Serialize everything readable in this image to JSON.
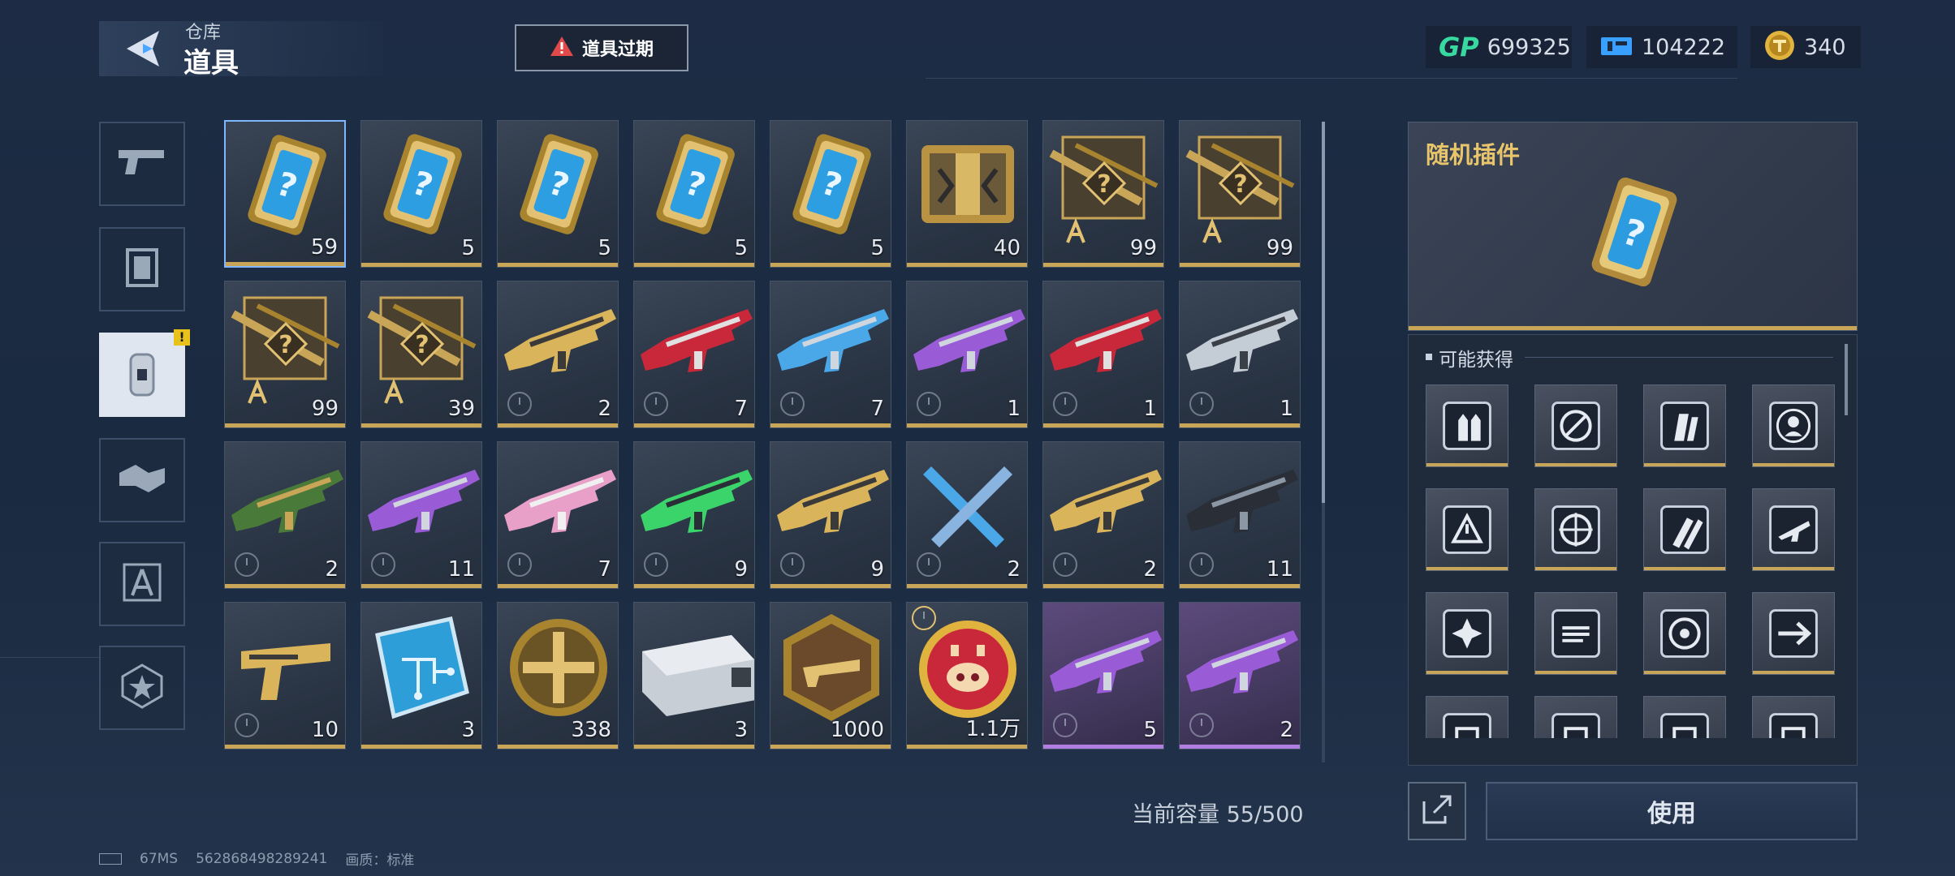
{
  "header": {
    "subtitle": "仓库",
    "title": "道具",
    "expire_button": "道具过期",
    "currencies": [
      {
        "icon": "gp-icon",
        "label": "GP",
        "value": "699325"
      },
      {
        "icon": "ticket-icon",
        "value": "104222"
      },
      {
        "icon": "gold-coin-icon",
        "value": "340"
      }
    ]
  },
  "sidebar": {
    "tabs": [
      {
        "icon": "pistol-icon",
        "active": false
      },
      {
        "icon": "character-frame-icon",
        "active": false
      },
      {
        "icon": "item-bag-icon",
        "active": true,
        "badge": "!"
      },
      {
        "icon": "handshake-icon",
        "active": false
      },
      {
        "icon": "compass-drafting-icon",
        "active": false
      },
      {
        "icon": "star-badge-icon",
        "active": false
      }
    ]
  },
  "inventory": {
    "items": [
      {
        "icon": "random-plugin-card",
        "count": "59",
        "selected": true
      },
      {
        "icon": "random-plugin-card",
        "count": "5"
      },
      {
        "icon": "random-plugin-card",
        "count": "5"
      },
      {
        "icon": "random-plugin-card",
        "count": "5"
      },
      {
        "icon": "random-plugin-card",
        "count": "5"
      },
      {
        "icon": "gold-supply-crate",
        "count": "40"
      },
      {
        "icon": "blueprint-mystery-rifle",
        "count": "99"
      },
      {
        "icon": "blueprint-mystery-rifle",
        "count": "99"
      },
      {
        "icon": "blueprint-mystery-rifle",
        "count": "99"
      },
      {
        "icon": "blueprint-mystery-rifle",
        "count": "39"
      },
      {
        "icon": "gold-rifle-skin",
        "count": "2",
        "timed": true
      },
      {
        "icon": "red-rifle-skin",
        "count": "7",
        "timed": true
      },
      {
        "icon": "blue-rifle-skin",
        "count": "7",
        "timed": true
      },
      {
        "icon": "purple-rifle-skin",
        "count": "1",
        "timed": true
      },
      {
        "icon": "dark-red-rifle-skin",
        "count": "1",
        "timed": true
      },
      {
        "icon": "silver-sniper-skin",
        "count": "1",
        "timed": true
      },
      {
        "icon": "camo-rifle-skin",
        "count": "2",
        "timed": true
      },
      {
        "icon": "purple-rifle-skin",
        "count": "11",
        "timed": true
      },
      {
        "icon": "pink-rifle-skin",
        "count": "7",
        "timed": true
      },
      {
        "icon": "green-rifle-skin",
        "count": "9",
        "timed": true
      },
      {
        "icon": "gold-rifle-skin",
        "count": "9",
        "timed": true
      },
      {
        "icon": "blue-knife-skin",
        "count": "2",
        "timed": true
      },
      {
        "icon": "gold-sniper-skin",
        "count": "2",
        "timed": true
      },
      {
        "icon": "dark-rifle-skin",
        "count": "11",
        "timed": true
      },
      {
        "icon": "gold-pistol-skin",
        "count": "10",
        "timed": true
      },
      {
        "icon": "blue-chip-card",
        "count": "3"
      },
      {
        "icon": "gold-cross-medal",
        "count": "338"
      },
      {
        "icon": "silver-ammo-box",
        "count": "3"
      },
      {
        "icon": "bronze-weapon-badge",
        "count": "1000"
      },
      {
        "icon": "red-pig-coin",
        "count": "1.1万",
        "timed_top": true
      },
      {
        "icon": "purple-smg-skin",
        "count": "5",
        "timed": true,
        "rarity": "purple"
      },
      {
        "icon": "purple-rifle-skin",
        "count": "2",
        "timed": true,
        "rarity": "purple"
      }
    ],
    "capacity_label": "当前容量 55/500"
  },
  "detail": {
    "title": "随机插件",
    "icon": "random-plugin-card",
    "rewards_heading": "可能获得",
    "rewards": [
      {
        "icon": "bullet-upgrade-icon"
      },
      {
        "icon": "no-scope-icon"
      },
      {
        "icon": "magazine-icon"
      },
      {
        "icon": "target-person-icon"
      },
      {
        "icon": "warning-magazine-icon"
      },
      {
        "icon": "crosshair-icon"
      },
      {
        "icon": "ammo-icon"
      },
      {
        "icon": "rifle-plugin-icon"
      },
      {
        "icon": "shuriken-icon"
      },
      {
        "icon": "stock-icon"
      },
      {
        "icon": "scope-ring-icon"
      },
      {
        "icon": "dash-icon"
      },
      {
        "icon": "plugin-icon"
      },
      {
        "icon": "plugin-icon"
      },
      {
        "icon": "plugin-icon"
      },
      {
        "icon": "plugin-icon"
      }
    ],
    "use_button": "使用"
  },
  "footer": {
    "ping": "67MS",
    "uid": "562868498289241",
    "quality": "画质：标准"
  }
}
